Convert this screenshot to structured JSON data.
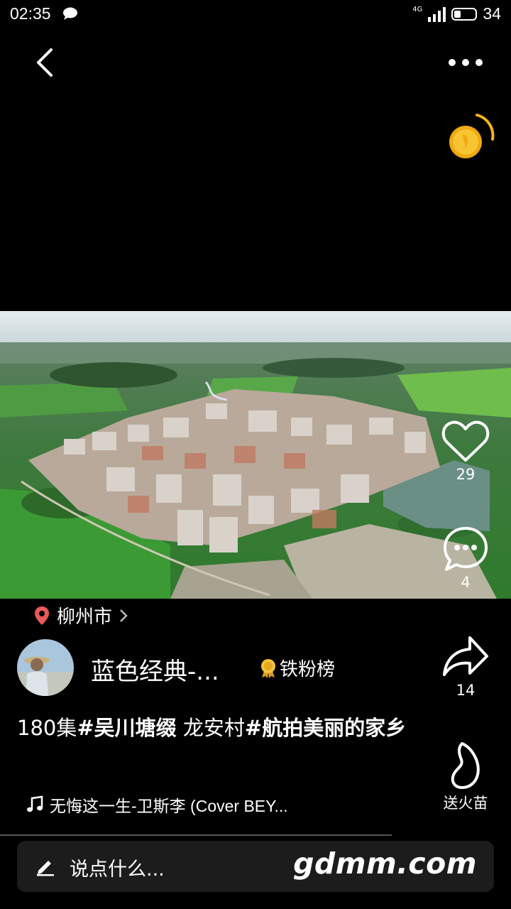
{
  "status_bar": {
    "time": "02:35",
    "network": "4G",
    "battery": "34"
  },
  "video": {
    "likes": "29",
    "comments": "4",
    "shares": "14",
    "gift_label": "送火苗"
  },
  "location": {
    "city": "柳州市"
  },
  "author": {
    "name": "蓝色经典-...",
    "fan_rank_label": "铁粉榜"
  },
  "caption": {
    "prefix": "180集",
    "tag1": "#吴川塘缀",
    "middle": "  龙安村",
    "tag2": "#航拍美丽的家乡"
  },
  "music": {
    "title": "无悔这一生-卫斯李 (Cover BEY..."
  },
  "comment_input": {
    "placeholder": "说点什么..."
  },
  "watermark": "gdmm.com",
  "colors": {
    "background": "#000000",
    "location_pin": "#e85a5a",
    "coin": "#f2b416",
    "input_bg": "#1c1c1c"
  }
}
